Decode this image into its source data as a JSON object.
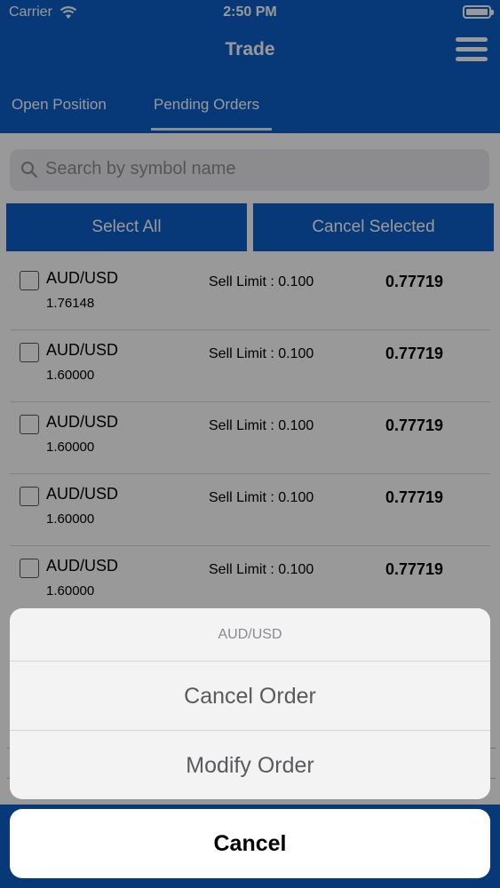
{
  "status_bar": {
    "carrier": "Carrier",
    "time": "2:50 PM"
  },
  "header": {
    "title": "Trade"
  },
  "tabs": [
    {
      "label": "Open Position"
    },
    {
      "label": "Pending Orders"
    }
  ],
  "search": {
    "placeholder": "Search by symbol name"
  },
  "actions": {
    "select_all": "Select All",
    "cancel_selected": "Cancel Selected"
  },
  "orders": [
    {
      "symbol": "AUD/USD",
      "price": "1.76148",
      "type": "Sell Limit : 0.100",
      "value": "0.77719"
    },
    {
      "symbol": "AUD/USD",
      "price": "1.60000",
      "type": "Sell Limit : 0.100",
      "value": "0.77719"
    },
    {
      "symbol": "AUD/USD",
      "price": "1.60000",
      "type": "Sell Limit : 0.100",
      "value": "0.77719"
    },
    {
      "symbol": "AUD/USD",
      "price": "1.60000",
      "type": "Sell Limit : 0.100",
      "value": "0.77719"
    },
    {
      "symbol": "AUD/USD",
      "price": "1.60000",
      "type": "Sell Limit : 0.100",
      "value": "0.77719"
    }
  ],
  "action_sheet": {
    "title": "AUD/USD",
    "options": [
      "Cancel Order",
      "Modify Order"
    ],
    "cancel": "Cancel"
  },
  "colors": {
    "brand_blue": "#0d5fc9",
    "overlay": "rgba(0,0,0,0.4)"
  }
}
